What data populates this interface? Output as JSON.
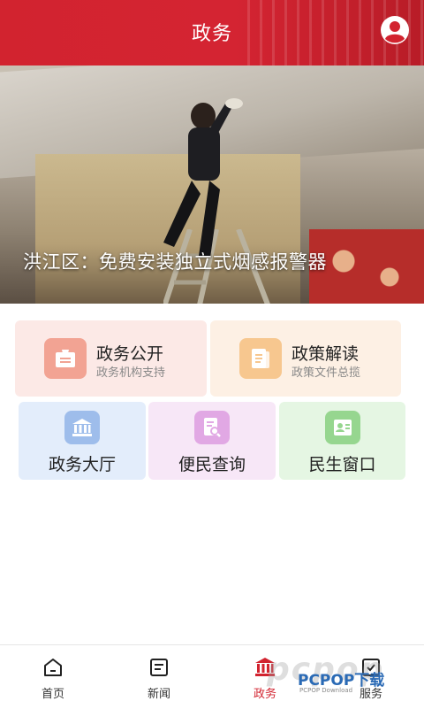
{
  "header": {
    "title": "政务"
  },
  "banner": {
    "caption": "洪江区：免费安装独立式烟感报警器",
    "slide_count": 5,
    "active_slide": 2
  },
  "cards": {
    "open": {
      "title": "政务公开",
      "subtitle": "政务机构支持",
      "icon": "notice-icon"
    },
    "policy": {
      "title": "政策解读",
      "subtitle": "政策文件总揽",
      "icon": "document-icon"
    },
    "hall": {
      "title": "政务大厅",
      "icon": "government-building-icon"
    },
    "query": {
      "title": "便民查询",
      "icon": "search-document-icon"
    },
    "life": {
      "title": "民生窗口",
      "icon": "id-card-icon"
    }
  },
  "tabs": [
    {
      "label": "首页",
      "icon": "home-icon"
    },
    {
      "label": "新闻",
      "icon": "news-icon"
    },
    {
      "label": "政务",
      "icon": "government-icon",
      "active": true
    },
    {
      "label": "服务",
      "icon": "service-icon"
    }
  ],
  "watermark": {
    "text": "PCPOP下载",
    "small": "PCPOP Download"
  },
  "colors": {
    "accent": "#d2232f"
  }
}
